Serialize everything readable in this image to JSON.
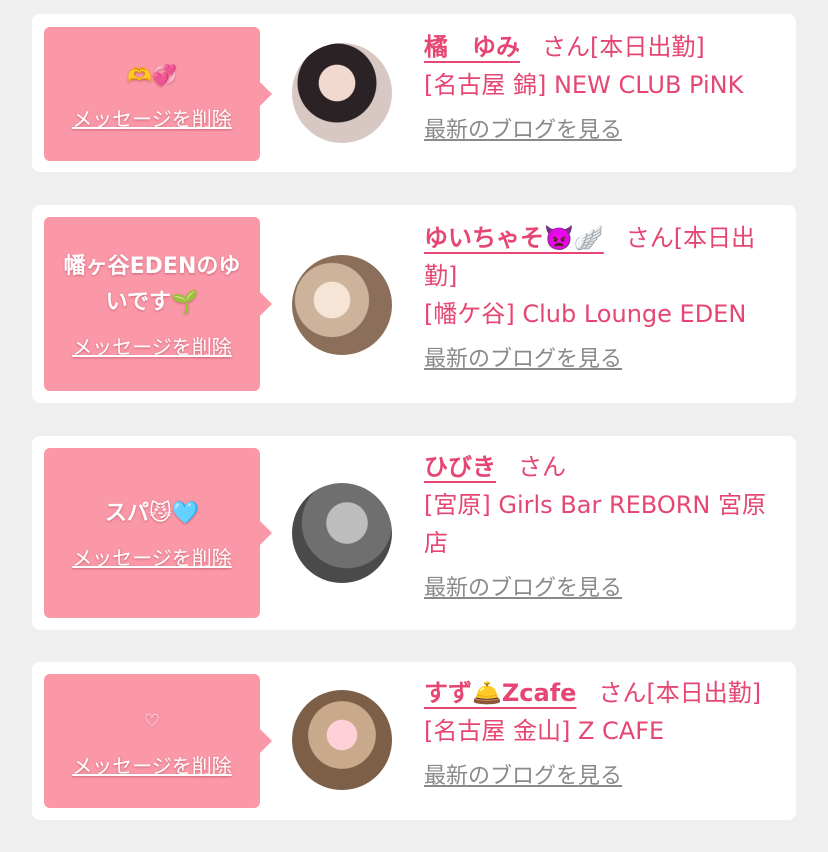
{
  "delete_label": "メッセージを削除",
  "blog_label": "最新のブログを見る",
  "honorific": "さん",
  "colors": {
    "accent": "#e64673",
    "bubble": "#fa98a8",
    "background": "#efefef"
  },
  "cards": [
    {
      "message": "🫶💞",
      "name": "橘　ゆみ",
      "status": "[本日出勤]",
      "shop": "[名古屋 錦] NEW CLUB PiNK"
    },
    {
      "message": "幡ヶ谷EDENのゆいです🌱",
      "name": "ゆいちゃそ👿🪽",
      "status": "[本日出勤]",
      "shop": "[幡ケ谷] Club Lounge EDEN"
    },
    {
      "message": "スパ😼🩵",
      "name": "ひびき",
      "status": "",
      "shop": "[宮原] Girls Bar REBORN 宮原店"
    },
    {
      "message": "♡",
      "name": "すず🛎️Zcafe",
      "status": "[本日出勤]",
      "shop": "[名古屋 金山] Z CAFE"
    }
  ]
}
